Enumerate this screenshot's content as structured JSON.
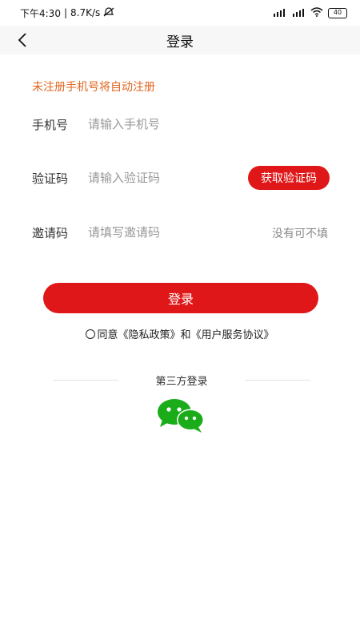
{
  "status_bar": {
    "time": "下午4:30",
    "speed": "8.7K/s",
    "battery": "40"
  },
  "nav": {
    "title": "登录"
  },
  "form": {
    "hint": "未注册手机号将自动注册",
    "phone": {
      "label": "手机号",
      "placeholder": "请输入手机号",
      "value": ""
    },
    "code": {
      "label": "验证码",
      "placeholder": "请输入验证码",
      "value": "",
      "button": "获取验证码"
    },
    "invite": {
      "label": "邀请码",
      "placeholder": "请填写邀请码",
      "value": "",
      "note": "没有可不填"
    }
  },
  "login_button": "登录",
  "agreement": {
    "prefix": "同意",
    "privacy": "《隐私政策》",
    "conjunction": "和",
    "terms": "《用户服务协议》",
    "checked": false
  },
  "third_party": {
    "title": "第三方登录",
    "providers": [
      {
        "icon": "wechat-icon"
      }
    ]
  },
  "colors": {
    "accent": "#e01718",
    "hint": "#e0651f",
    "wechat": "#1aad19"
  }
}
